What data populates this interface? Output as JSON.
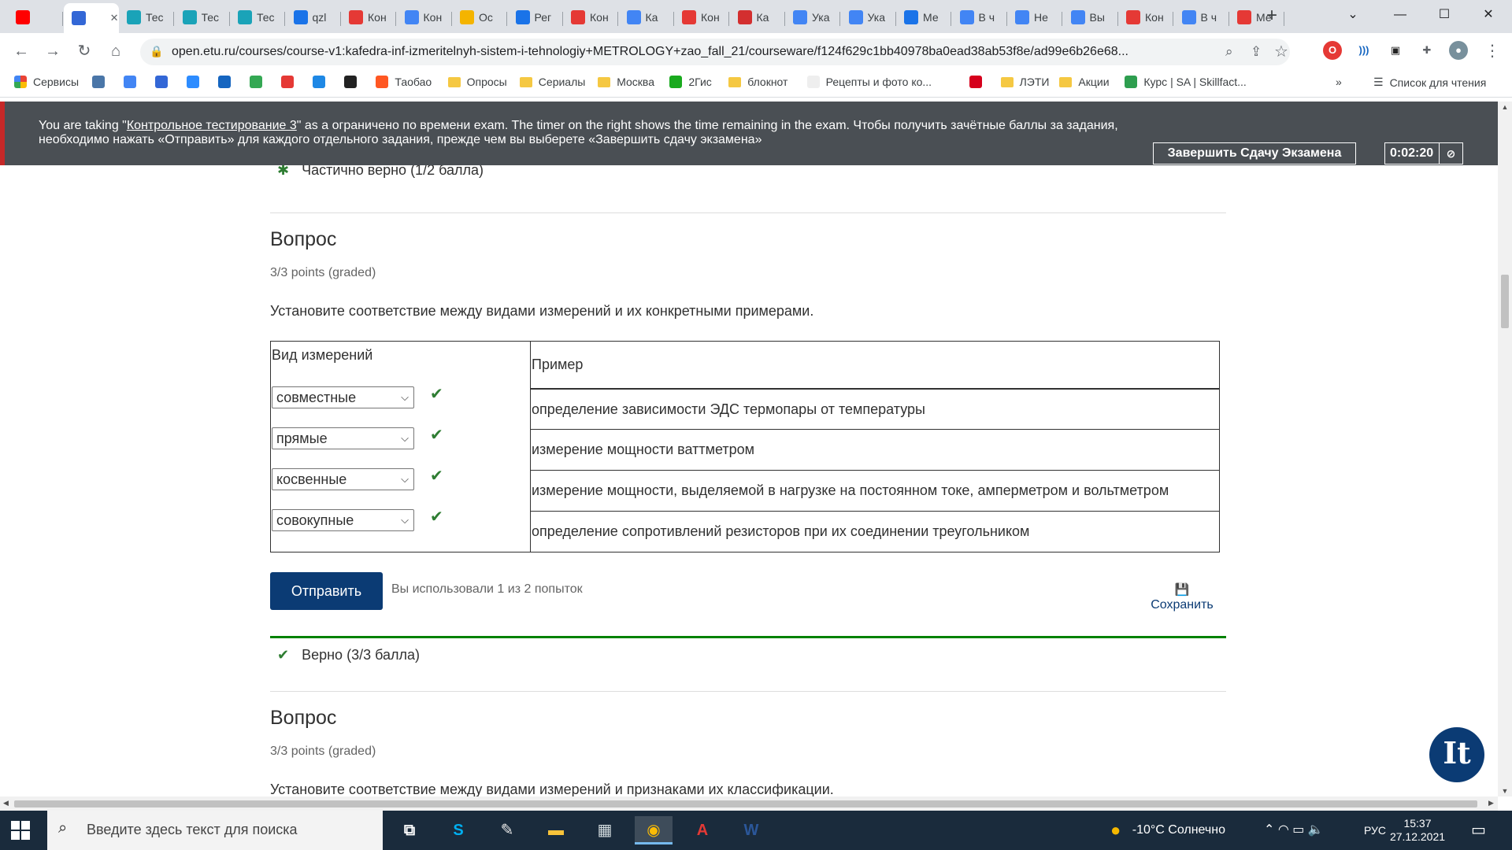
{
  "browser": {
    "tabs": [
      {
        "title": "",
        "color": "#ff0000",
        "active": false
      },
      {
        "title": "",
        "color": "#3367d6",
        "active": true
      },
      {
        "title": "Тес",
        "color": "#1aa3b8",
        "active": false
      },
      {
        "title": "Тес",
        "color": "#1aa3b8",
        "active": false
      },
      {
        "title": "Тес",
        "color": "#1aa3b8",
        "active": false
      },
      {
        "title": "qzl",
        "color": "#1a73e8",
        "active": false
      },
      {
        "title": "Кон",
        "color": "#e53935",
        "active": false
      },
      {
        "title": "Кон",
        "color": "#4285f4",
        "active": false
      },
      {
        "title": "Ос",
        "color": "#f4b400",
        "active": false
      },
      {
        "title": "Рег",
        "color": "#1a73e8",
        "active": false
      },
      {
        "title": "Кон",
        "color": "#e53935",
        "active": false
      },
      {
        "title": "Ка",
        "color": "#4285f4",
        "active": false
      },
      {
        "title": "Кон",
        "color": "#e53935",
        "active": false
      },
      {
        "title": "Ка",
        "color": "#d32f2f",
        "active": false
      },
      {
        "title": "Ука",
        "color": "#4285f4",
        "active": false
      },
      {
        "title": "Ука",
        "color": "#4285f4",
        "active": false
      },
      {
        "title": "Ме",
        "color": "#1a73e8",
        "active": false
      },
      {
        "title": "В ч",
        "color": "#4285f4",
        "active": false
      },
      {
        "title": "Не",
        "color": "#4285f4",
        "active": false
      },
      {
        "title": "Вы",
        "color": "#4285f4",
        "active": false
      },
      {
        "title": "Кон",
        "color": "#e53935",
        "active": false
      },
      {
        "title": "В ч",
        "color": "#4285f4",
        "active": false
      },
      {
        "title": "Ме",
        "color": "#e53935",
        "active": false
      }
    ],
    "new_tab": "+",
    "window_buttons": {
      "dropdown": "⌄",
      "minimize": "—",
      "maximize": "☐",
      "close": "✕"
    },
    "url": "open.etu.ru/courses/course-v1:kafedra-inf-izmeritelnyh-sistem-i-tehnologiy+METROLOGY+zao_fall_21/courseware/f124f629c1bb40978ba0ead38ab53f8e/ad99e6b26e68...",
    "nav": {
      "back": "←",
      "forward": "→",
      "reload": "↻",
      "home": "⌂",
      "lock": "🔒",
      "zoom": "⌕",
      "share": "⇪",
      "star": "☆",
      "menu": "⋮"
    },
    "bookmarks": [
      {
        "label": "Сервисы",
        "kind": "apps"
      },
      {
        "label": "",
        "kind": "vk",
        "color": "#4a76a8"
      },
      {
        "label": "",
        "kind": "icon",
        "color": "#4285f4"
      },
      {
        "label": "",
        "kind": "icon",
        "color": "#3367d6"
      },
      {
        "label": "",
        "kind": "icon",
        "color": "#2d8cff"
      },
      {
        "label": "",
        "kind": "icon",
        "color": "#1565c0"
      },
      {
        "label": "",
        "kind": "icon",
        "color": "#34a853"
      },
      {
        "label": "",
        "kind": "icon",
        "color": "#e53935"
      },
      {
        "label": "",
        "kind": "icon",
        "color": "#1e88e5"
      },
      {
        "label": "",
        "kind": "icon",
        "color": "#222222"
      },
      {
        "label": "Таобао",
        "kind": "icon",
        "color": "#ff5722"
      },
      {
        "label": "Опросы",
        "kind": "folder"
      },
      {
        "label": "Сериалы",
        "kind": "folder"
      },
      {
        "label": "Москва",
        "kind": "folder"
      },
      {
        "label": "2Гис",
        "kind": "icon",
        "color": "#19aa1e"
      },
      {
        "label": "блокнот",
        "kind": "folder"
      },
      {
        "label": "Рецепты и фото ко...",
        "kind": "icon",
        "color": "#eeeeee"
      },
      {
        "label": "",
        "kind": "icon",
        "color": "#d6001c"
      },
      {
        "label": "ЛЭТИ",
        "kind": "folder"
      },
      {
        "label": "Акции",
        "kind": "folder"
      },
      {
        "label": "Курс | SA | Skillfact...",
        "kind": "icon",
        "color": "#2e9e4f"
      }
    ],
    "bookmarks_more": "»",
    "reading_list": "Список для чтения"
  },
  "exam": {
    "line1_before": "You are taking \"",
    "exam_name": "Контрольное тестирование 3",
    "line1_after": "\" as a ограничено по времени exam. The timer on the right shows the time remaining in the exam. Чтобы получить зачётные баллы за задания,",
    "line2": "необходимо нажать «Отправить» для каждого отдельного задания, прежде чем вы выберете «Завершить сдачу экзамена»",
    "finish_label": "Завершить Сдачу Экзамена",
    "timer": "0:02:20",
    "accent_color": "#c62828"
  },
  "content": {
    "prev_result": {
      "icon": "asterisk-icon",
      "text": "Частично верно (1/2 балла)"
    },
    "question1": {
      "title": "Вопрос",
      "points": "3/3 points (graded)",
      "prompt": "Установите соответствие между видами измерений и их конкретными примерами.",
      "table": {
        "col_left": "Вид измерений",
        "col_right": "Пример",
        "rows": [
          {
            "selected": "совместные",
            "example": "определение зависимости ЭДС термопары от температуры"
          },
          {
            "selected": "прямые",
            "example": "измерение мощности ваттметром"
          },
          {
            "selected": "косвенные",
            "example": "измерение мощности, выделяемой в нагрузке на постоянном токе, амперметром и вольтметром"
          },
          {
            "selected": "совокупные",
            "example": "определение сопротивлений резисторов при их соединении треугольником"
          }
        ]
      },
      "submit_label": "Отправить",
      "attempts": "Вы использовали 1 из 2 попыток",
      "save_label": "Сохранить",
      "result": {
        "icon": "checkmark-icon",
        "text": "Верно (3/3 балла)"
      }
    },
    "question2": {
      "title": "Вопрос",
      "points": "3/3 points (graded)",
      "prompt": "Установите соответствие между видами измерений и признаками их классификации."
    },
    "badge": "It",
    "brand_color": "#0b3b74",
    "success_color": "#008100"
  },
  "taskbar": {
    "search_placeholder": "Введите здесь текст для поиска",
    "apps": [
      {
        "name": "task-view",
        "glyph": "⧉",
        "color": "#ffffff"
      },
      {
        "name": "skype",
        "glyph": "S",
        "color": "#00aff0"
      },
      {
        "name": "paint",
        "glyph": "✎",
        "color": "#e9e9e9"
      },
      {
        "name": "file-explorer",
        "glyph": "▬",
        "color": "#f8c33a"
      },
      {
        "name": "calculator",
        "glyph": "▦",
        "color": "#cfd8dc"
      },
      {
        "name": "chrome",
        "glyph": "◉",
        "color": "#fbbc05"
      },
      {
        "name": "acrobat",
        "glyph": "A",
        "color": "#e53935"
      },
      {
        "name": "word",
        "glyph": "W",
        "color": "#2b579a"
      }
    ],
    "weather": "-10°C  Солнечно",
    "tray_icons": "⌃  ◠  ▭  🔈",
    "lang": "РУС",
    "time": "15:37",
    "date": "27.12.2021",
    "notifications": "▭"
  }
}
